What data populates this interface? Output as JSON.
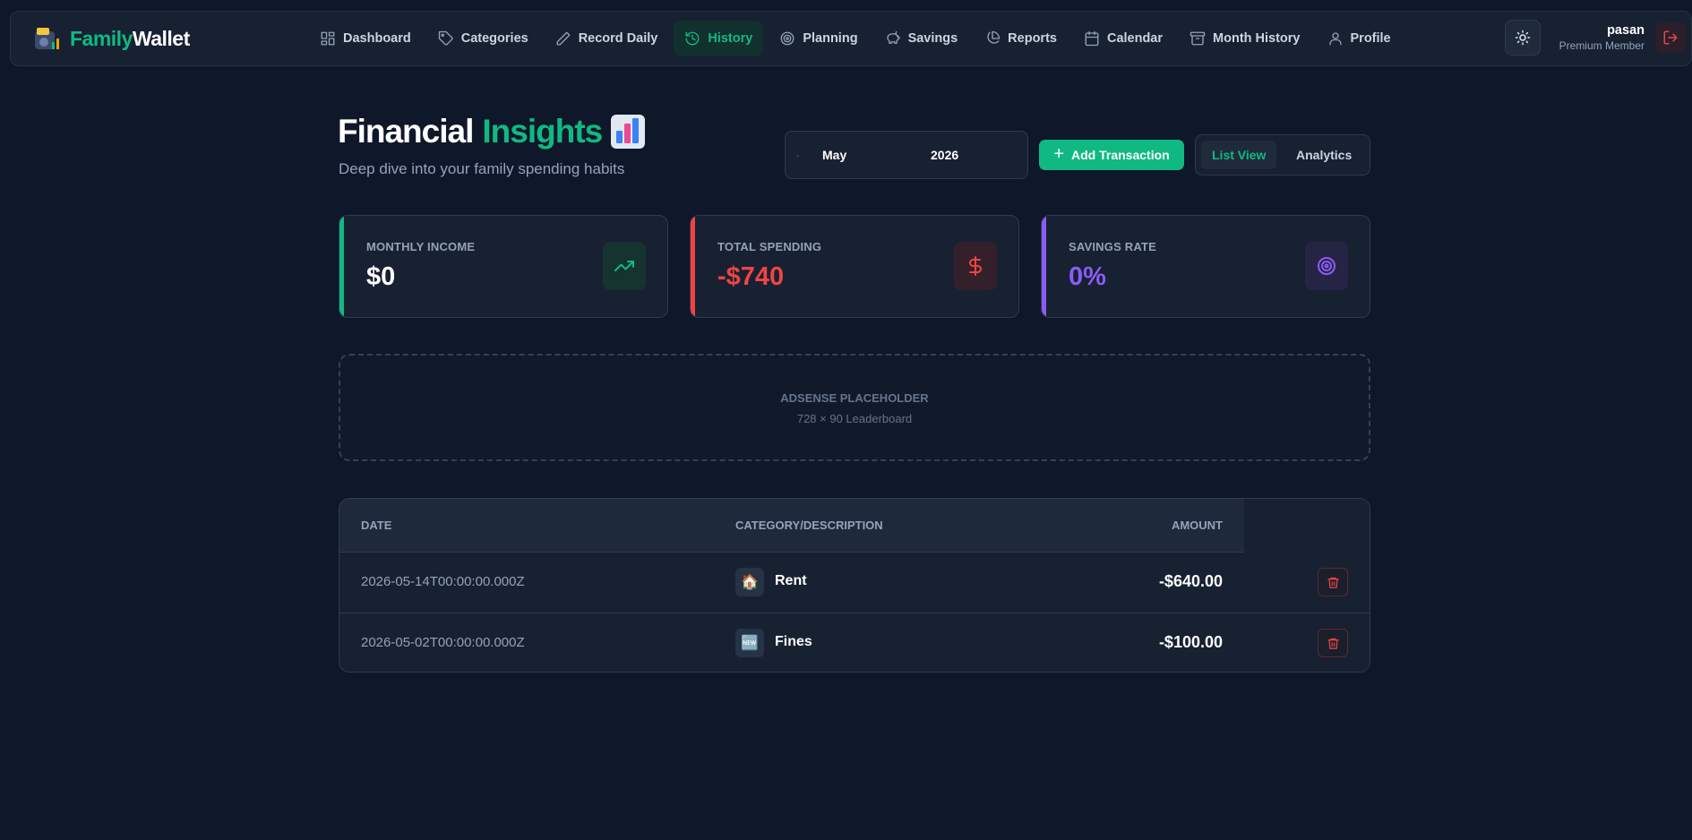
{
  "brand": {
    "part1": "Family",
    "part2": "Wallet"
  },
  "nav": {
    "items": [
      {
        "label": "Dashboard",
        "icon": "dashboard-icon",
        "active": false
      },
      {
        "label": "Categories",
        "icon": "tag-icon",
        "active": false
      },
      {
        "label": "Record Daily",
        "icon": "pencil-icon",
        "active": false
      },
      {
        "label": "History",
        "icon": "history-icon",
        "active": true
      },
      {
        "label": "Planning",
        "icon": "target-icon",
        "active": false
      },
      {
        "label": "Savings",
        "icon": "piggy-bank-icon",
        "active": false
      },
      {
        "label": "Reports",
        "icon": "pie-chart-icon",
        "active": false
      },
      {
        "label": "Calendar",
        "icon": "calendar-icon",
        "active": false
      },
      {
        "label": "Month History",
        "icon": "archive-icon",
        "active": false
      },
      {
        "label": "Profile",
        "icon": "user-icon",
        "active": false
      }
    ]
  },
  "user": {
    "name": "pasan",
    "role": "Premium Member"
  },
  "header": {
    "title_part1": "Financial",
    "title_part2": "Insights",
    "subtitle": "Deep dive into your family spending habits",
    "month": "May",
    "year": "2026",
    "add_button": "Add Transaction",
    "view_list": "List View",
    "view_analytics": "Analytics"
  },
  "stats": [
    {
      "label": "MONTHLY INCOME",
      "value": "$0",
      "color": "#10b981",
      "icon": "trending-up-icon"
    },
    {
      "label": "TOTAL SPENDING",
      "value": "-$740",
      "color": "#ef4444",
      "icon": "dollar-icon"
    },
    {
      "label": "SAVINGS RATE",
      "value": "0%",
      "color": "#8b5cf6",
      "icon": "target-icon"
    }
  ],
  "ad": {
    "title": "ADSENSE PLACEHOLDER",
    "size": "728 × 90 Leaderboard"
  },
  "table": {
    "headers": {
      "date": "DATE",
      "category": "CATEGORY/DESCRIPTION",
      "amount": "AMOUNT"
    },
    "rows": [
      {
        "date": "2026-05-14T00:00:00.000Z",
        "icon": "🏠",
        "category": "Rent",
        "amount": "-$640.00"
      },
      {
        "date": "2026-05-02T00:00:00.000Z",
        "icon": "🆕",
        "category": "Fines",
        "amount": "-$100.00"
      }
    ]
  }
}
